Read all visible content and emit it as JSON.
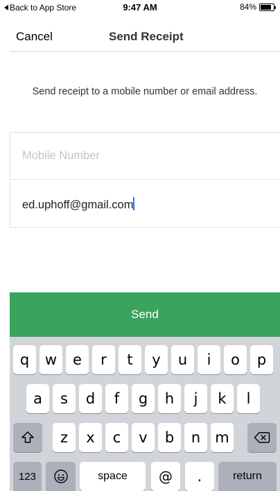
{
  "status_bar": {
    "back_label": "Back to App Store",
    "time": "9:47 AM",
    "battery_percent": "84%",
    "battery_level": 0.84
  },
  "nav": {
    "cancel_label": "Cancel",
    "title": "Send Receipt"
  },
  "instructions": "Send receipt to a mobile number or email address.",
  "form": {
    "mobile_placeholder": "Mobile Number",
    "email_value": "ed.uphoff@gmail.com"
  },
  "send_button": {
    "label": "Send",
    "color": "#3aa35c"
  },
  "keyboard": {
    "row1": [
      "q",
      "w",
      "e",
      "r",
      "t",
      "y",
      "u",
      "i",
      "o",
      "p"
    ],
    "row2": [
      "a",
      "s",
      "d",
      "f",
      "g",
      "h",
      "j",
      "k",
      "l"
    ],
    "row3": [
      "z",
      "x",
      "c",
      "v",
      "b",
      "n",
      "m"
    ],
    "shift_icon": "shift-icon",
    "backspace_icon": "backspace-icon",
    "numbers_label": "123",
    "emoji_icon": "emoji-icon",
    "space_label": "space",
    "at_label": "@",
    "period_label": ".",
    "return_label": "return"
  }
}
